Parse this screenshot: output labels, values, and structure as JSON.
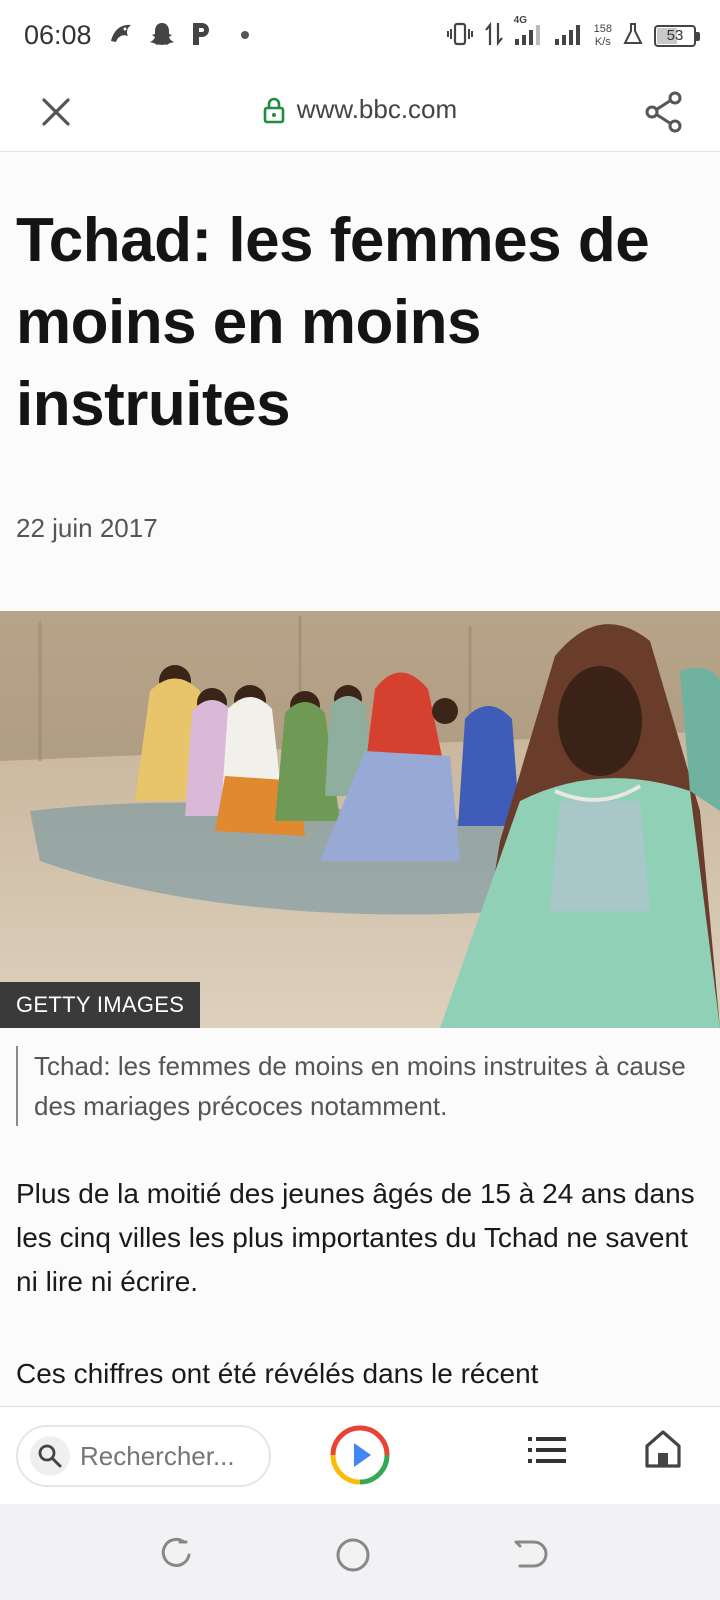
{
  "status_bar": {
    "time": "06:08",
    "network_type": "4G",
    "net_speed_value": "158",
    "net_speed_unit": "K/s",
    "battery_level": "53"
  },
  "url_bar": {
    "url": "www.bbc.com",
    "secure_color": "#1e8e3e"
  },
  "article": {
    "headline": "Tchad: les femmes de moins en moins instruites",
    "date": "22 juin 2017",
    "image_credit": "GETTY IMAGES",
    "caption": "Tchad: les femmes de moins en moins instruites à cause des mariages précoces notamment.",
    "paragraphs": [
      "Plus de la moitié des jeunes âgés de 15 à 24 ans dans les cinq villes les plus importantes du Tchad ne savent ni lire ni écrire.",
      "Ces chiffres ont été révélés dans le récent"
    ]
  },
  "bottom_bar": {
    "search_placeholder": "Rechercher..."
  },
  "icons": {
    "status_left": [
      "snapchat-icon",
      "p-app-icon",
      "dot-icon"
    ],
    "status_right": [
      "vibrate-icon",
      "data-arrows-icon",
      "signal-icon",
      "signal-icon-2",
      "lab-flask-icon",
      "battery-icon"
    ],
    "url_bar": [
      "close-icon",
      "lock-icon",
      "share-icon"
    ],
    "bottom_bar": [
      "search-icon",
      "play-icon",
      "list-icon",
      "home-icon"
    ],
    "nav_bar": [
      "recent-apps-icon",
      "home-circle-icon",
      "back-icon"
    ]
  }
}
